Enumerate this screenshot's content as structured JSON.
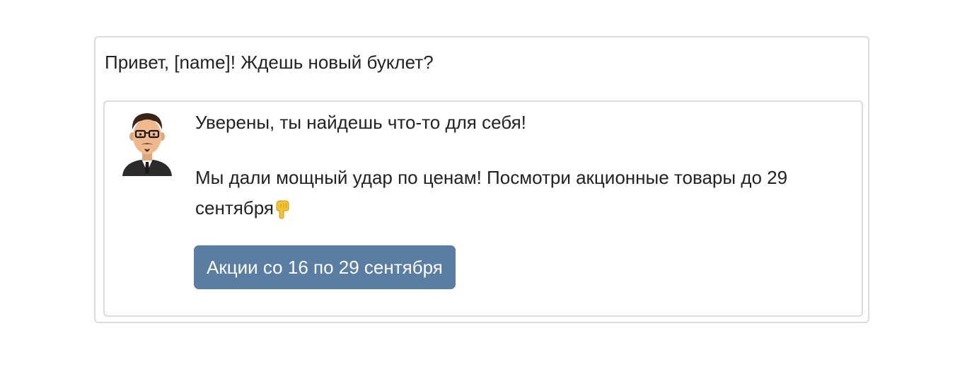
{
  "message": {
    "greeting": "Привет, [name]! Ждешь новый буклет?",
    "line1": "Уверены, ты найдешь что-то для себя!",
    "line2": "Мы дали мощный удар по ценам! Посмотри акционные товары до 29 сентября",
    "emoji": "pointing-down-hand-icon",
    "avatar": "cartoon-man-with-glasses-avatar"
  },
  "button": {
    "label": "Акции со 16 по 29 сентября",
    "color": "#5a7ea3"
  },
  "colors": {
    "border": "#dcdcdc",
    "text": "#222222"
  }
}
